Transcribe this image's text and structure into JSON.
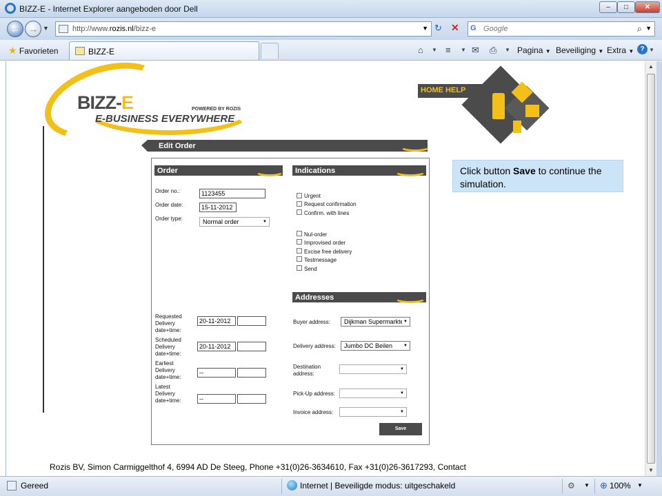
{
  "window": {
    "title": "BIZZ-E - Internet Explorer aangeboden door Dell",
    "minimize_glyph": "–",
    "maximize_glyph": "□",
    "close_glyph": "✕"
  },
  "nav": {
    "back_glyph": "←",
    "forward_glyph": "→",
    "dropdown_glyph": "▼",
    "url_prefix": "http://www.",
    "url_host": "rozis.nl",
    "url_path": "/bizz-e",
    "refresh_glyph": "↻",
    "stop_glyph": "✕",
    "search_provider_glyph": "G",
    "search_placeholder": "Google",
    "search_glyph": "⌕"
  },
  "favorites_bar": {
    "favorites_label": "Favorieten",
    "star_glyph": "★",
    "tab_label": "BIZZ-E",
    "commands": {
      "home_glyph": "⌂",
      "feeds_glyph": "≡",
      "mail_glyph": "✉",
      "print_glyph": "⎙",
      "page_label": "Pagina",
      "security_label": "Beveiliging",
      "extra_label": "Extra",
      "help_glyph": "?",
      "arrow": "▼"
    }
  },
  "logo": {
    "bizz": "BIZZ-",
    "e": "E",
    "powered": "POWERED BY ROZIS",
    "tagline": "E-BUSINESS EVERYWHERE"
  },
  "home_help": "HOME HELP",
  "edit_order": {
    "title": "Edit Order",
    "order_section": {
      "title": "Order",
      "order_no_label": "Order no.:",
      "order_no_value": "1123455",
      "order_date_label": "Order date:",
      "order_date_value": "15-11-2012",
      "order_type_label": "Order type:",
      "order_type_value": "Normal order"
    },
    "indications": {
      "title": "Indications",
      "items": [
        "Urgent",
        "Request confirmation",
        "Confirm. with lines",
        "Nul-order",
        "Improvised order",
        "Excise free delivery",
        "Testmessage",
        "Send"
      ]
    },
    "dates": {
      "requested_label_1": "Requested",
      "requested_label_2": "Delivery",
      "requested_label_3": "date+time:",
      "requested_value": "20-11-2012",
      "scheduled_label_1": "Scheduled",
      "scheduled_label_2": "Delivery",
      "scheduled_label_3": "date+time:",
      "scheduled_value": "20-11-2012",
      "earliest_label_1": "Earliest",
      "earliest_label_2": "Delivery",
      "earliest_label_3": "date+time:",
      "earliest_value": "--",
      "latest_label_1": "Latest",
      "latest_label_2": "Delivery",
      "latest_label_3": "date+time:",
      "latest_value": "--"
    },
    "addresses": {
      "title": "Addresses",
      "buyer_label": "Buyer address:",
      "buyer_value": "Dijkman Supermarkten",
      "delivery_label": "Delivery address:",
      "delivery_value": "Jumbo DC Beilen",
      "destination_label_1": "Destination",
      "destination_label_2": "address:",
      "pickup_label": "Pick-Up address:",
      "invoice_label": "Invoice address:"
    },
    "save_label": "Save"
  },
  "instruction": {
    "prefix": "Click button ",
    "button": "Save",
    "suffix": " to continue the simulation."
  },
  "footer": "Rozis BV, Simon Carmiggelthof 4, 6994 AD De Steeg, Phone +31(0)26-3634610, Fax +31(0)26-3617293, Contact",
  "statusbar": {
    "status": "Gereed",
    "zone": "Internet | Beveiligde modus: uitgeschakeld",
    "zoom": "100%",
    "zoom_glyph": "⊕",
    "gear_glyph": "⚙",
    "arrow": "▼"
  },
  "colors": {
    "accent": "#f2c019",
    "dark": "#4b4b4b",
    "callout": "#cce4f8"
  }
}
